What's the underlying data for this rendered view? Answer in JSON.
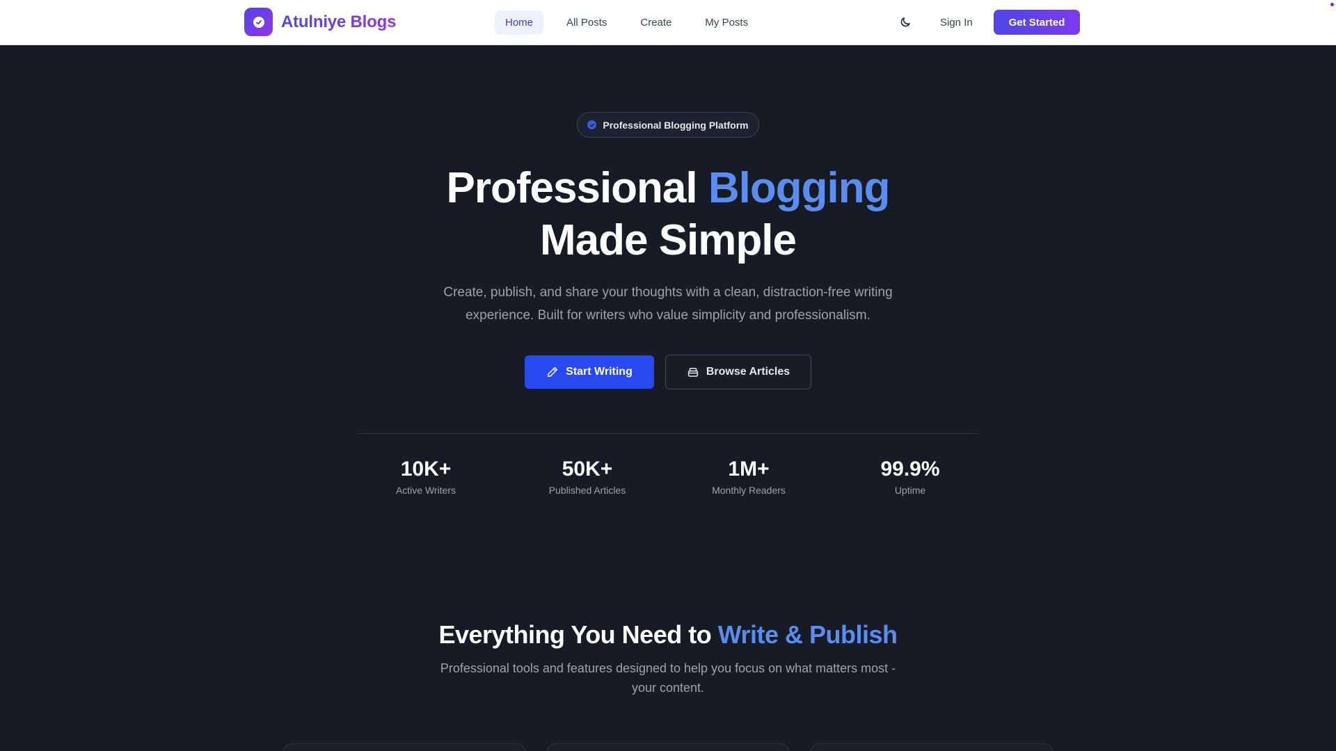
{
  "navbar": {
    "brand_name": "Atulniye Blogs",
    "links": [
      {
        "label": "Home"
      },
      {
        "label": "All Posts"
      },
      {
        "label": "Create"
      },
      {
        "label": "My Posts"
      }
    ],
    "sign_in_label": "Sign In",
    "get_started_label": "Get Started",
    "theme_icon": "moon-icon"
  },
  "hero": {
    "badge_text": "Professional Blogging Platform",
    "title_part1": "Professional ",
    "title_accent": "Blogging",
    "title_line2": "Made Simple",
    "subtitle": "Create, publish, and share your thoughts with a clean, distraction-free writing experience. Built for writers who value simplicity and professionalism.",
    "primary_button_label": "Start Writing",
    "primary_button_icon": "pencil-icon",
    "secondary_button_label": "Browse Articles",
    "secondary_button_icon": "archive-icon"
  },
  "stats": [
    {
      "value": "10K+",
      "label": "Active Writers"
    },
    {
      "value": "50K+",
      "label": "Published Articles"
    },
    {
      "value": "1M+",
      "label": "Monthly Readers"
    },
    {
      "value": "99.9%",
      "label": "Uptime"
    }
  ],
  "features": {
    "title_part1": "Everything You Need to ",
    "title_accent": "Write & Publish",
    "subtitle": "Professional tools and features designed to help you focus on what matters most - your content."
  },
  "colors": {
    "brand_gradient_start": "#4f46e5",
    "brand_gradient_end": "#9333ea",
    "accent_text": "#5b8def",
    "primary_button": "#2848f0",
    "background": "#161b26"
  }
}
